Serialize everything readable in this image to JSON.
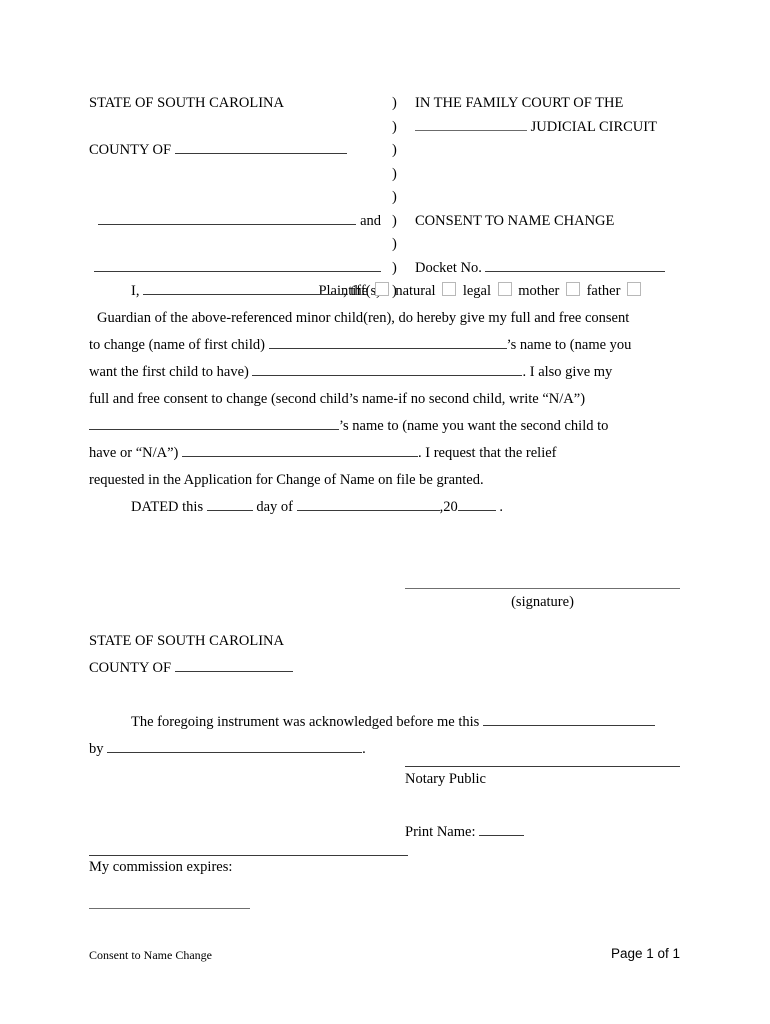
{
  "document": {
    "title": "Consent to Name Change",
    "page_label": "Page 1 of 1"
  },
  "caption": {
    "left": {
      "state": "STATE OF SOUTH CAROLINA",
      "county_label": "COUNTY OF",
      "and_label": "and",
      "plaintiff_label": "Plaintiff(s)"
    },
    "paren": ")",
    "right": {
      "court_line1": "IN THE FAMILY COURT OF THE",
      "circuit_suffix": "JUDICIAL CIRCUIT",
      "case_title": "CONSENT TO NAME CHANGE",
      "docket_label": "Docket No."
    }
  },
  "body": {
    "line1_prefix": "I,",
    "line1_mid": ", the",
    "checkbox_natural": "natural",
    "checkbox_legal": "legal",
    "checkbox_mother": "mother",
    "checkbox_father": "father",
    "line2": "Guardian of the above-referenced minor child(ren), do hereby give my full and free consent",
    "line3_prefix": "to change (name of first child)",
    "line3_suffix": "’s name to (name you",
    "line4_prefix": "want the first child to have)",
    "line4_suffix": ". I also give my",
    "line5": "full and free consent to change (second child’s name-if no second child, write “N/A”)",
    "line6_suffix": "’s name to (name you want the second child to",
    "line7_prefix": "have or “N/A”)",
    "line7_suffix": ". I request that the relief",
    "line8": "requested in the Application for Change of Name on file be granted.",
    "dated_prefix": "DATED this",
    "dated_mid": "day of",
    "dated_year_prefix": ",20",
    "dated_suffix": "."
  },
  "signature": {
    "label": "(signature)"
  },
  "notary": {
    "state": "STATE OF SOUTH CAROLINA",
    "county_label": "COUNTY OF",
    "ack_prefix": "The foregoing instrument was acknowledged before me this",
    "ack_by_prefix": "by",
    "ack_by_suffix": ".",
    "notary_public_label": "Notary Public",
    "print_name_label": "Print Name:",
    "commission_label": "My commission expires:"
  }
}
